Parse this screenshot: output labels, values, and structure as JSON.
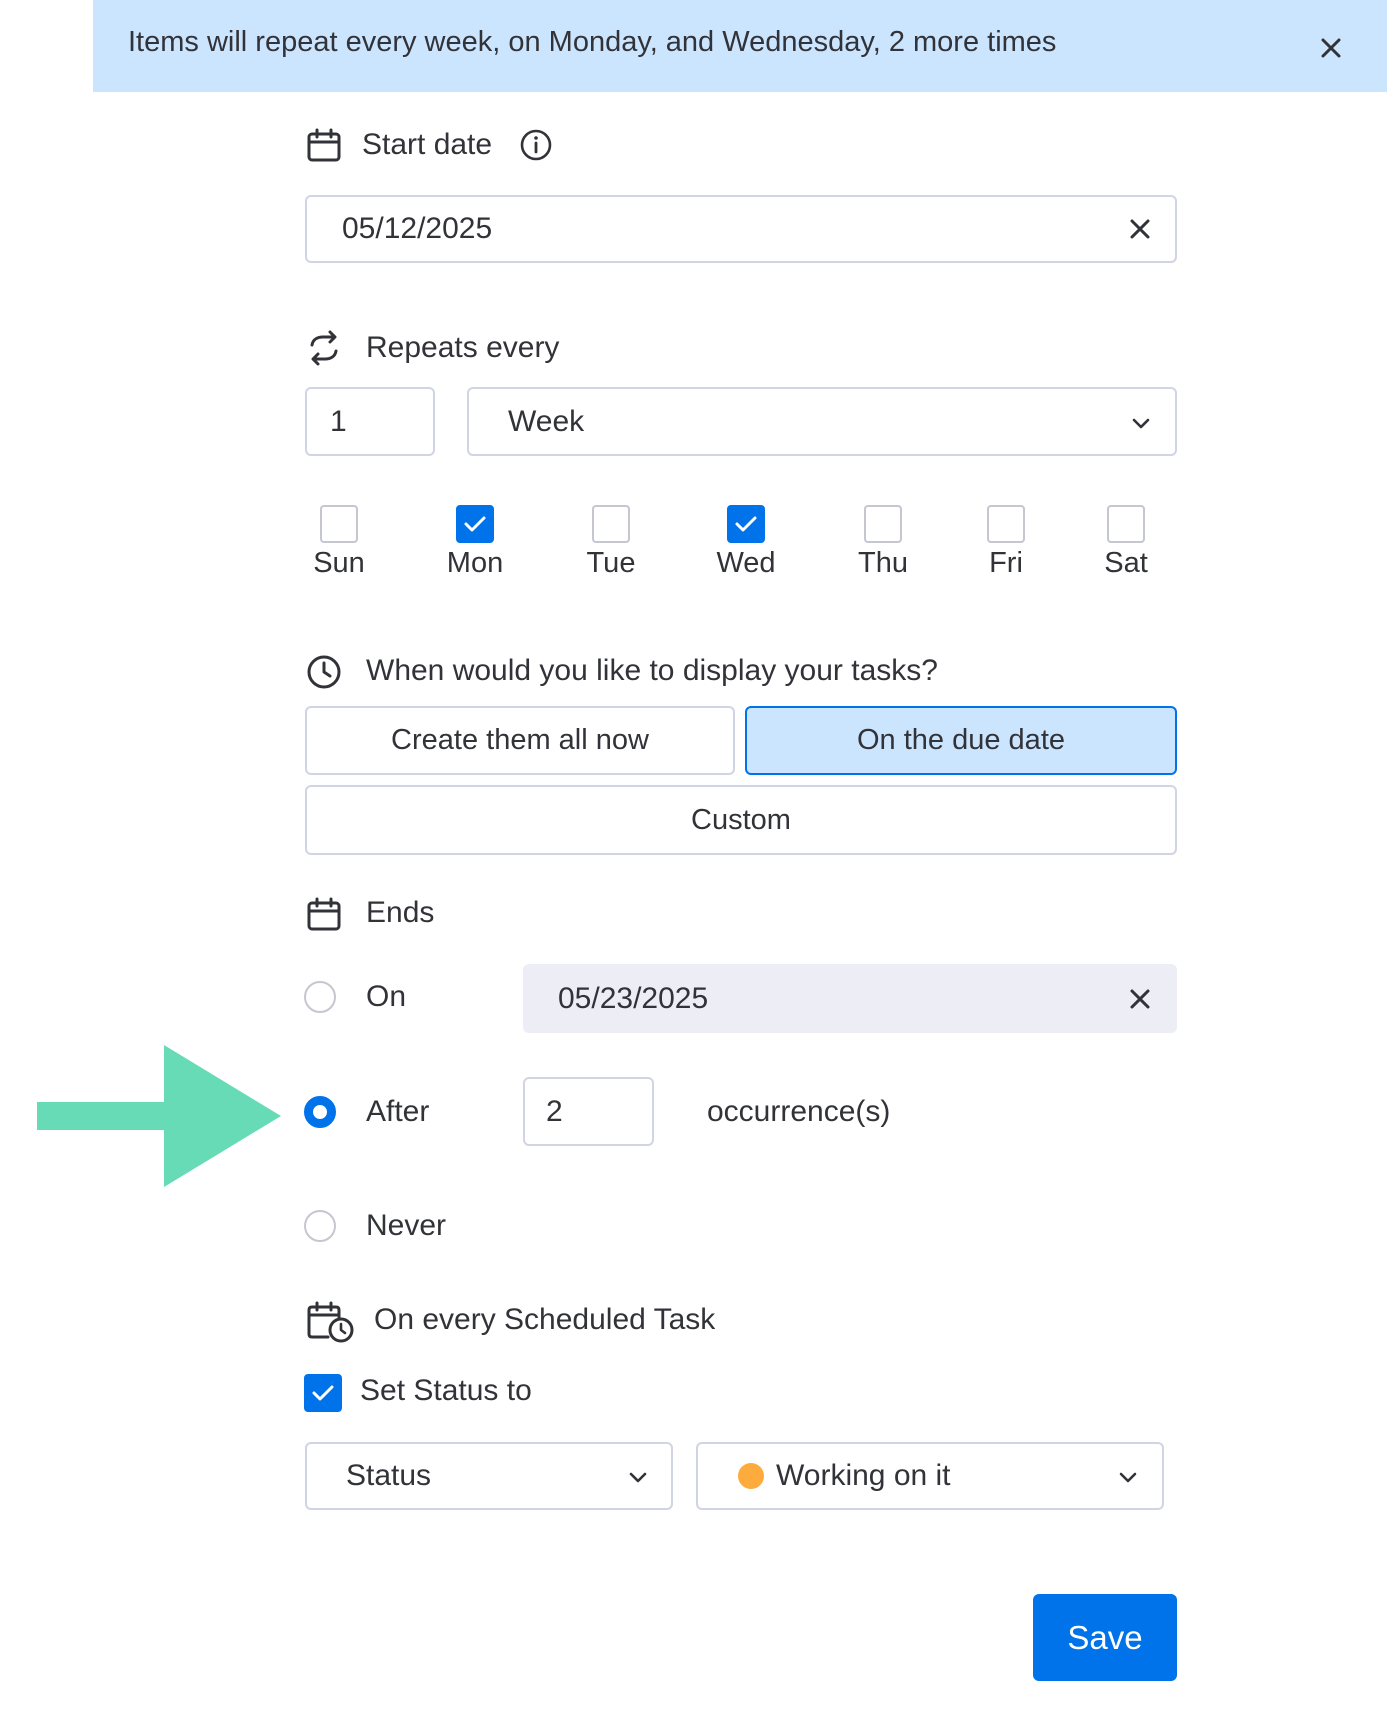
{
  "banner": {
    "message": "Items will repeat every week, on Monday, and Wednesday, 2 more times"
  },
  "start_date": {
    "label": "Start date",
    "value": "05/12/2025"
  },
  "repeats": {
    "label": "Repeats every",
    "interval": "1",
    "unit": "Week"
  },
  "days": [
    {
      "label": "Sun",
      "checked": false
    },
    {
      "label": "Mon",
      "checked": true
    },
    {
      "label": "Tue",
      "checked": false
    },
    {
      "label": "Wed",
      "checked": true
    },
    {
      "label": "Thu",
      "checked": false
    },
    {
      "label": "Fri",
      "checked": false
    },
    {
      "label": "Sat",
      "checked": false
    }
  ],
  "display": {
    "question": "When would you like to display your tasks?",
    "options": [
      "Create them all now",
      "On the due date",
      "Custom"
    ],
    "selected": "On the due date"
  },
  "ends": {
    "label": "Ends",
    "on_label": "On",
    "on_date": "05/23/2025",
    "after_label": "After",
    "after_count": "2",
    "occurrences_label": "occurrence(s)",
    "never_label": "Never",
    "selected": "After"
  },
  "scheduled": {
    "label": "On every Scheduled Task",
    "set_status_label": "Set Status to",
    "set_status_checked": true,
    "column": "Status",
    "value": "Working on it",
    "value_color": "#fdab3d"
  },
  "save_label": "Save",
  "colors": {
    "accent": "#0073ea",
    "banner_bg": "#cce5ff",
    "arrow": "#67dbb6"
  }
}
